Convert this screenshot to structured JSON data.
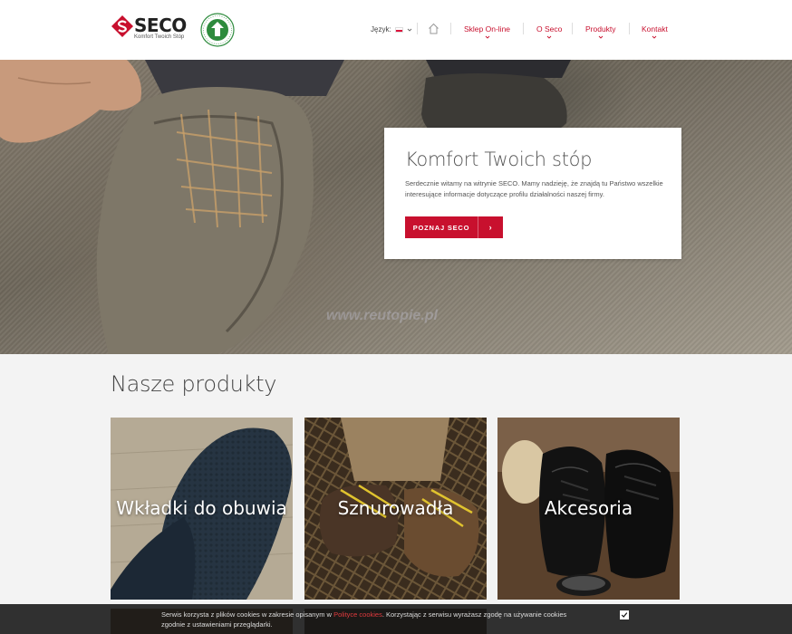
{
  "header": {
    "logo_text": "SECO",
    "logo_tagline": "Komfort Twoich Stóp",
    "language_label": "Język:",
    "nav": [
      {
        "label": "Sklep On-line"
      },
      {
        "label": "O Seco"
      },
      {
        "label": "Produkty"
      },
      {
        "label": "Kontakt"
      }
    ]
  },
  "hero": {
    "title": "Komfort Twoich stóp",
    "description": "Serdecznie witamy na witrynie SECO. Mamy nadzieję, że znajdą tu Państwo wszelkie interesujące informacje dotyczące profilu działalności naszej firmy.",
    "button_label": "POZNAJ SECO",
    "button_arrow": "›",
    "watermark": "www.reutopie.pl"
  },
  "products": {
    "title": "Nasze produkty",
    "items": [
      {
        "label": "Wkładki do obuwia"
      },
      {
        "label": "Sznurowadła"
      },
      {
        "label": "Akcesoria"
      }
    ]
  },
  "cookie": {
    "text_before": "Serwis korzysta z plików cookies w zakresie opisanym w ",
    "link": "Polityce cookies",
    "text_after": ". Korzystając z serwisu wyrażasz zgodę na używanie cookies zgodnie z ustawieniami przeglądarki."
  },
  "colors": {
    "brand_red": "#c8102e",
    "hero_card": "#ffffff",
    "cookie_bar": "#141414"
  }
}
